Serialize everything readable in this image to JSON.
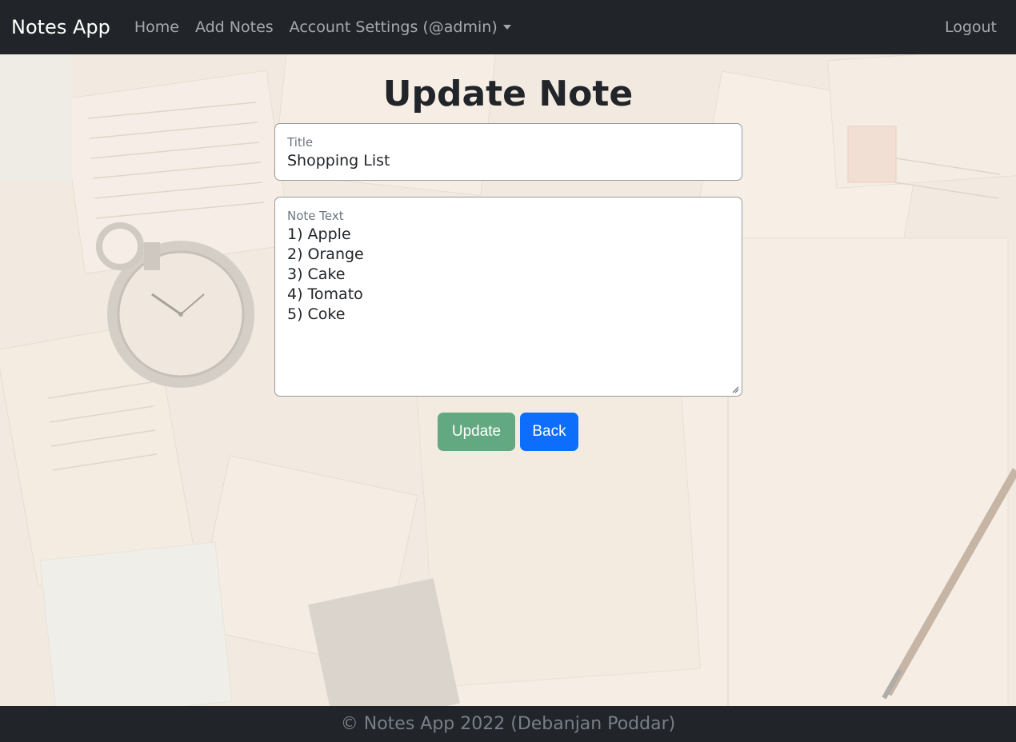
{
  "navbar": {
    "brand": "Notes App",
    "links": [
      "Home",
      "Add Notes",
      "Account Settings (@admin)"
    ],
    "logout": "Logout"
  },
  "page": {
    "title": "Update Note"
  },
  "form": {
    "title_label": "Title",
    "title_value": "Shopping List",
    "text_label": "Note Text",
    "text_value": "1) Apple\n2) Orange\n3) Cake\n4) Tomato\n5) Coke",
    "update_label": "Update",
    "back_label": "Back"
  },
  "footer": {
    "text": "© Notes App 2022 (Debanjan Poddar)"
  },
  "colors": {
    "navbar_bg": "#212529",
    "update_button": "#62a880",
    "back_button": "#0d6efd"
  }
}
